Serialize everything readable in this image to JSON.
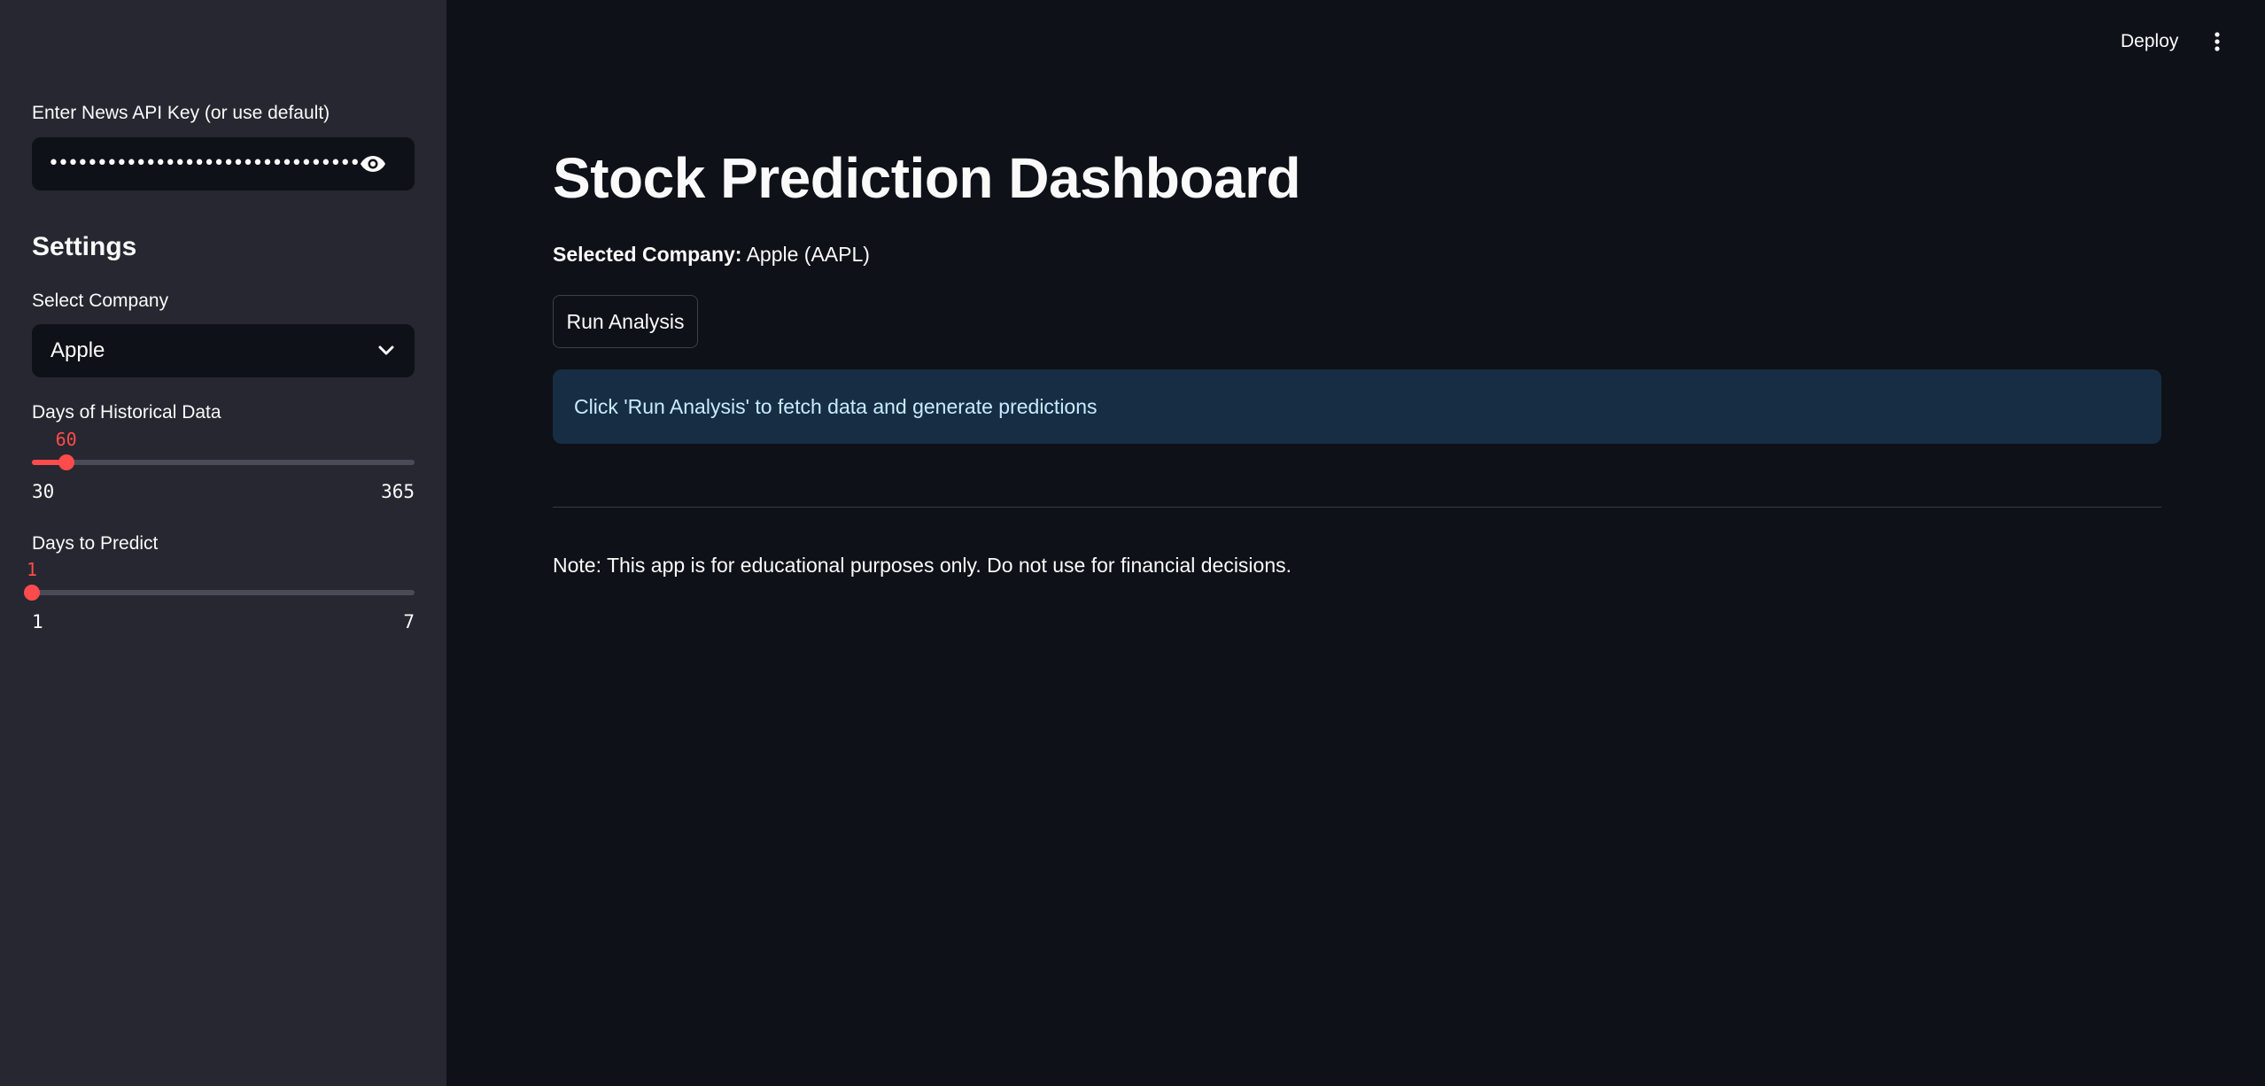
{
  "header": {
    "deploy_label": "Deploy",
    "menu_icon": "kebab-menu-icon"
  },
  "sidebar": {
    "api_key": {
      "label": "Enter News API Key (or use default)",
      "masked_value": "••••••••••••••••••••••••••••••••",
      "icon": "eye-icon"
    },
    "settings_title": "Settings",
    "company_select": {
      "label": "Select Company",
      "value": "Apple",
      "icon": "chevron-down-icon"
    },
    "history_slider": {
      "label": "Days of Historical Data",
      "value": "60",
      "min": "30",
      "max": "365",
      "value_num": 60,
      "min_num": 30,
      "max_num": 365
    },
    "predict_slider": {
      "label": "Days to Predict",
      "value": "1",
      "min": "1",
      "max": "7",
      "value_num": 1,
      "min_num": 1,
      "max_num": 7
    }
  },
  "main": {
    "title": "Stock Prediction Dashboard",
    "selected_label": "Selected Company:",
    "selected_value": "Apple (AAPL)",
    "run_button": "Run Analysis",
    "info_message": "Click 'Run Analysis' to fetch data and generate predictions",
    "note": "Note: This app is for educational purposes only. Do not use for financial decisions."
  },
  "colors": {
    "background": "#0e1117",
    "sidebar": "#262730",
    "accent": "#ff4b4b",
    "info_bg": "#172d43",
    "info_text": "#c7ebff"
  }
}
